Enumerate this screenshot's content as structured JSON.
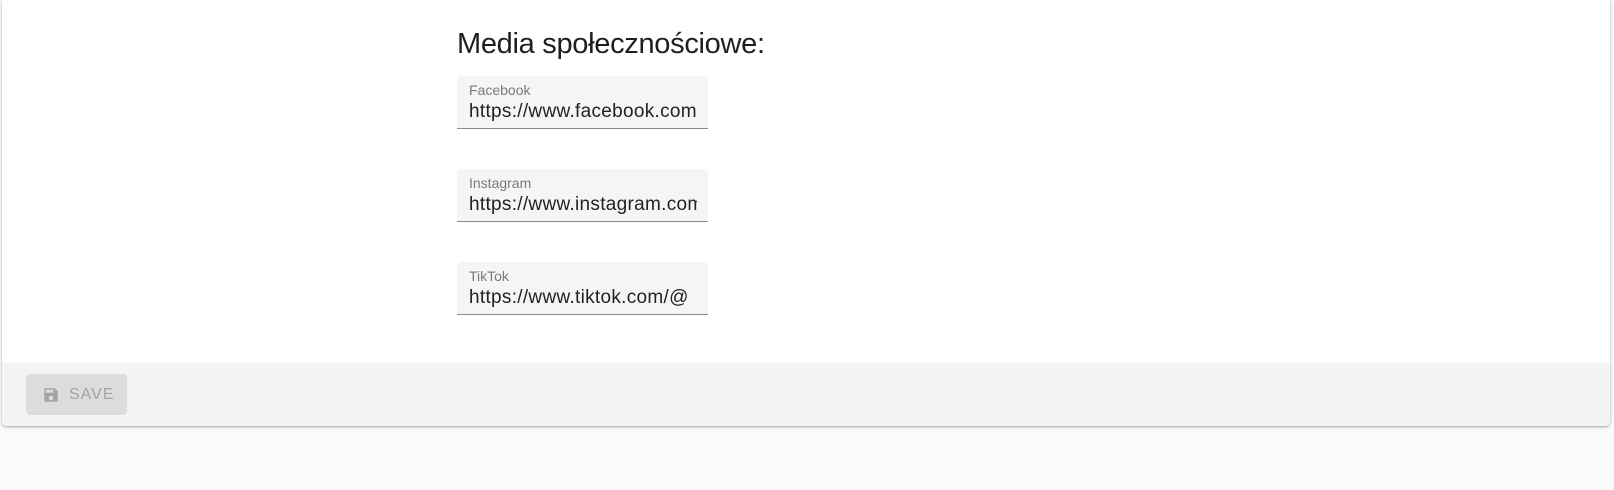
{
  "section": {
    "title": "Media społecznościowe:"
  },
  "fields": {
    "facebook": {
      "label": "Facebook",
      "value": "https://www.facebook.com/"
    },
    "instagram": {
      "label": "Instagram",
      "value": "https://www.instagram.com/"
    },
    "tiktok": {
      "label": "TikTok",
      "value": "https://www.tiktok.com/@"
    }
  },
  "actions": {
    "save_label": "SAVE",
    "save_icon": "floppy-disk-icon",
    "save_disabled": true
  },
  "colors": {
    "page_background": "#fafafa",
    "card_background": "#ffffff",
    "field_background": "#f5f5f5",
    "actions_bar_background": "#f4f4f4",
    "disabled_button_background": "#dcdcdc",
    "disabled_button_text": "#a3a3a3"
  }
}
